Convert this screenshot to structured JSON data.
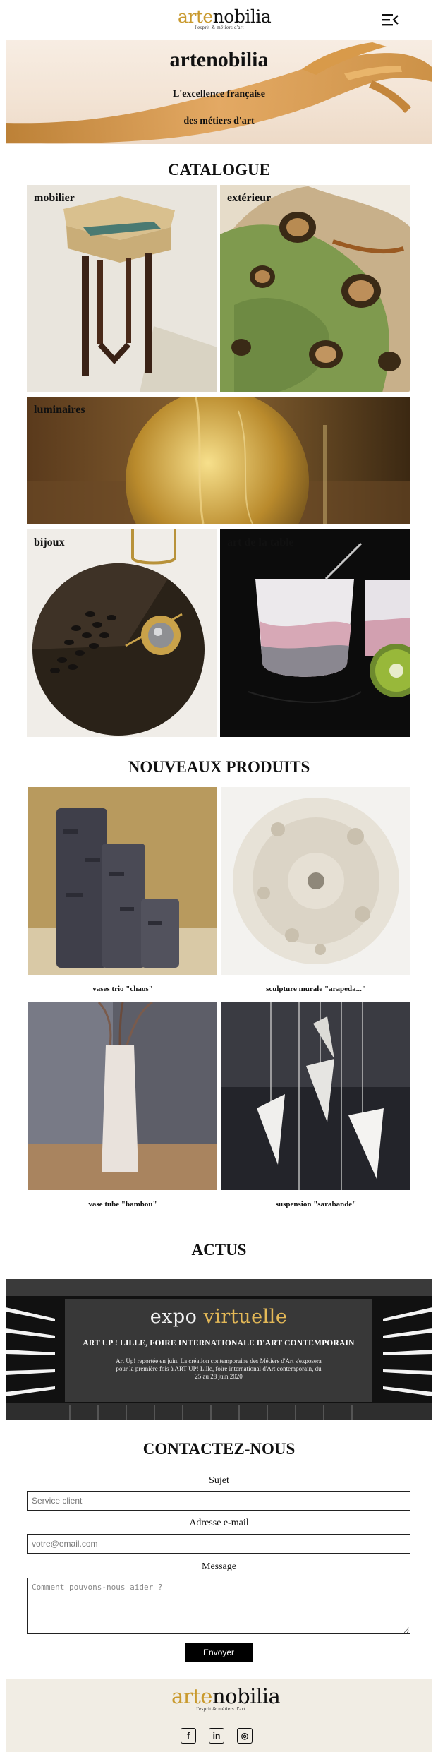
{
  "header": {
    "logo_prefix": "arte",
    "logo_suffix": "nobilia",
    "logo_tagline": "l'esprit & métiers d'art"
  },
  "hero": {
    "title": "artenobilia",
    "line1": "L'excellence française",
    "line2": "des métiers d'art"
  },
  "catalogue": {
    "title": "CATALOGUE",
    "items": [
      {
        "label": "mobilier"
      },
      {
        "label": "extérieur"
      },
      {
        "label": "luminaires"
      },
      {
        "label": "bijoux"
      },
      {
        "label": "art de la table"
      }
    ]
  },
  "products": {
    "title": "NOUVEAUX PRODUITS",
    "items": [
      {
        "caption": "vases trio \"chaos\""
      },
      {
        "caption": "sculpture murale \"arapeda...\""
      },
      {
        "caption": "vase tube \"bambou\""
      },
      {
        "caption": "suspension \"sarabande\""
      }
    ]
  },
  "actus": {
    "title": "ACTUS",
    "banner_word1": "expo",
    "banner_word2": "virtuelle",
    "headline": "ART UP ! LILLE, FOIRE INTERNATIONALE D'ART CONTEMPORAIN",
    "text": "Art Up! reportée en juin. La création contemporaine des Métiers d'Art s'exposera pour la première fois à ART UP! Lille, foire international d'Art contemporain, du 25 au 28 juin 2020"
  },
  "contact": {
    "title": "CONTACTEZ-NOUS",
    "subject_label": "Sujet",
    "subject_placeholder": "Service client",
    "email_label": "Adresse e-mail",
    "email_placeholder": "votre@email.com",
    "message_label": "Message",
    "message_placeholder": "Comment pouvons-nous aider ?",
    "send_label": "Envoyer"
  },
  "footer": {
    "logo_prefix": "arte",
    "logo_suffix": "nobilia",
    "logo_tagline": "l'esprit & métiers d'art",
    "socials": [
      {
        "icon": "facebook-icon",
        "glyph": "f"
      },
      {
        "icon": "linkedin-icon",
        "glyph": "in"
      },
      {
        "icon": "instagram-icon",
        "glyph": "◎"
      }
    ]
  },
  "colors": {
    "brand_gold": "#c99a2e",
    "footer_bg": "#f1ede4",
    "button_bg": "#000000"
  }
}
